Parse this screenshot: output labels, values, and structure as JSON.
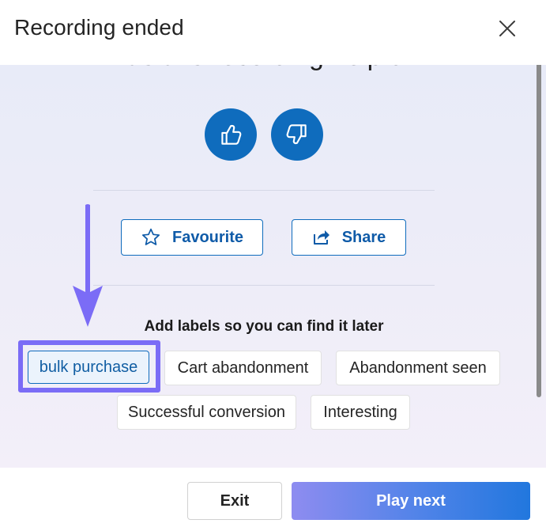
{
  "dialog": {
    "title": "Recording ended"
  },
  "feedback": {
    "question": "Was this recording helpful?"
  },
  "actions": {
    "favourite_label": "Favourite",
    "share_label": "Share"
  },
  "labels": {
    "heading": "Add labels so you can find it later",
    "chips": [
      {
        "label": "bulk purchase",
        "selected": true
      },
      {
        "label": "Cart abandonment",
        "selected": false
      },
      {
        "label": "Abandonment seen",
        "selected": false
      },
      {
        "label": "Successful conversion",
        "selected": false
      },
      {
        "label": "Interesting",
        "selected": false
      }
    ]
  },
  "footer": {
    "exit_label": "Exit",
    "play_next_label": "Play next"
  },
  "colors": {
    "accent": "#0f6cbd",
    "highlight": "#7b6cf6",
    "play_gradient_start": "#8e8cf0",
    "play_gradient_end": "#2177de"
  },
  "icons": [
    "close-icon",
    "thumbs-up-icon",
    "thumbs-down-icon",
    "star-icon",
    "share-icon",
    "arrow-down-icon"
  ]
}
